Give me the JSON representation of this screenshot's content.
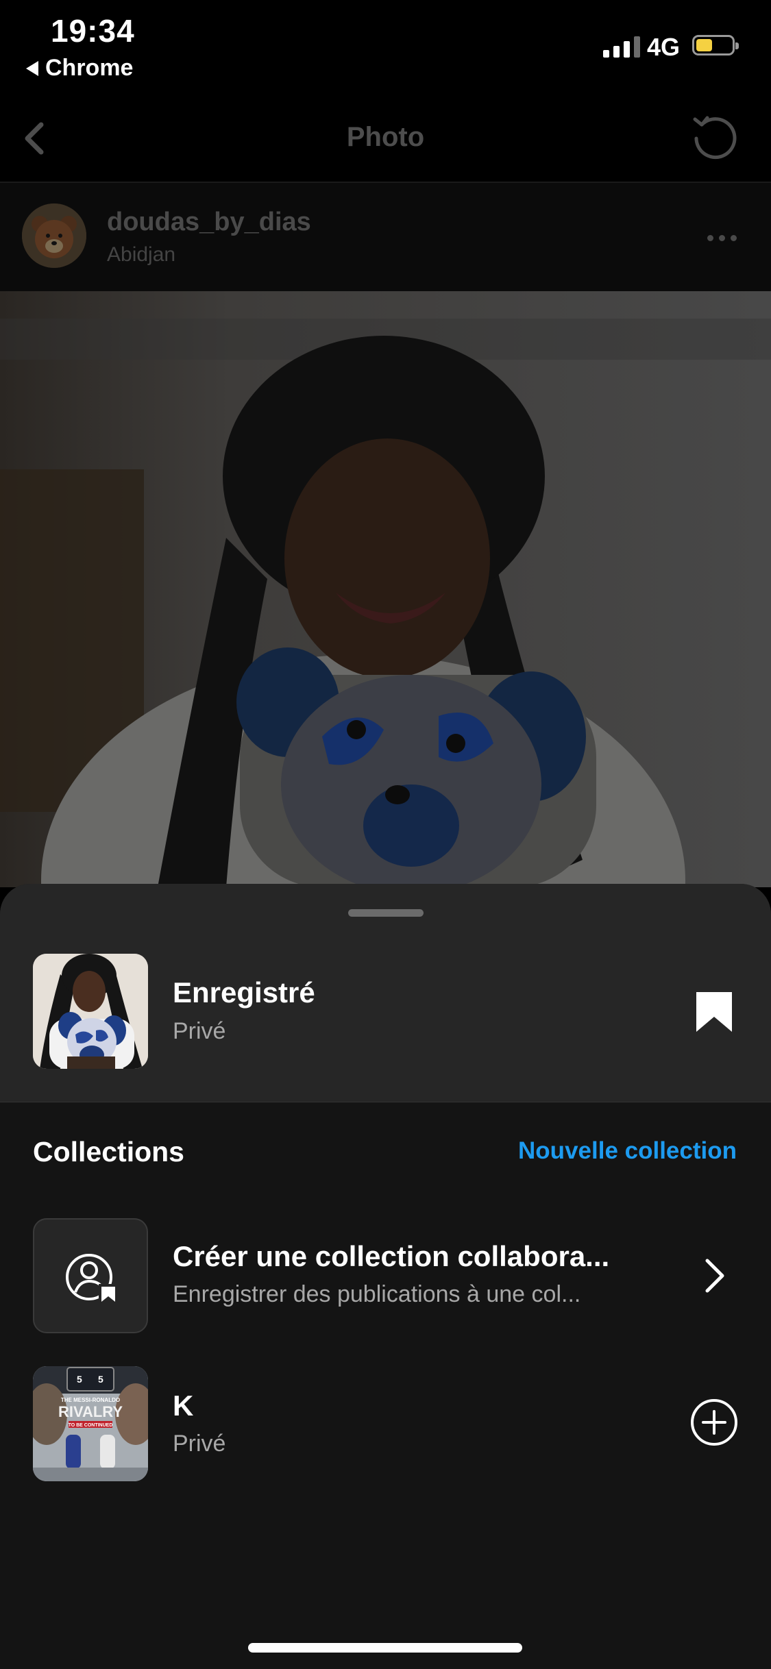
{
  "status_bar": {
    "time": "19:34",
    "back_app": "Chrome",
    "network": "4G",
    "battery_level": 0.45
  },
  "nav": {
    "title": "Photo"
  },
  "post": {
    "username": "doudas_by_dias",
    "location": "Abidjan"
  },
  "sheet": {
    "saved": {
      "title": "Enregistré",
      "subtitle": "Privé"
    },
    "collections_heading": "Collections",
    "new_collection_label": "Nouvelle collection",
    "collab": {
      "title": "Créer une collection collabora...",
      "subtitle": "Enregistrer des publications à une col..."
    },
    "items": [
      {
        "title": "K",
        "subtitle": "Privé",
        "thumb_text": [
          "5",
          "5",
          "THE MESSI-RONALDO",
          "RIVALRY",
          "TO BE CONTINUED"
        ]
      }
    ]
  },
  "colors": {
    "accent": "#1d9bf0",
    "sheet_bg": "#141414",
    "sheet_top_bg": "#262626",
    "muted": "#a8a8a8",
    "battery": "#f5d142"
  },
  "icons": [
    "back-chevron-icon",
    "refresh-icon",
    "more-icon",
    "bookmark-icon",
    "collab-person-icon",
    "chevron-right-icon",
    "add-circle-icon"
  ]
}
